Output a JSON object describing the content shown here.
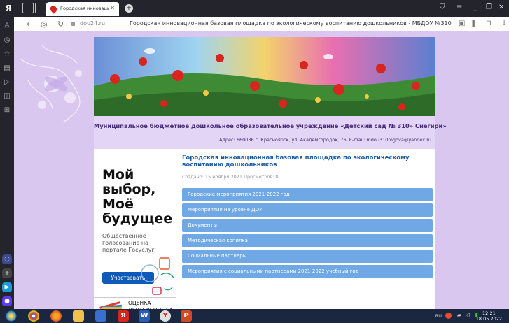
{
  "browser": {
    "tab_title": "Городская инновацио",
    "tab_close": "✕",
    "new_tab": "+",
    "url": "dou24.ru",
    "page_title": "Городская инновационная базовая площадка по экологическому воспитанию дошкольников - МБДОУ №310"
  },
  "site": {
    "org_name": "Муниципальное бюджетное дошкольное образовательное учреждение «Детский сад № 310» Снегири»",
    "address": "Адрес: 660036 г. Красноярск, ул. Академгородок, 76. E-mail: mdou310rogova@yandex.ru"
  },
  "gos_banner": {
    "headline": "Мой выбор, Моё будущее",
    "subtitle": "Общественное голосование на портале Госуслуг",
    "button_label": "Участвовать"
  },
  "rating": {
    "label": "ОЦЕНКА ДЕЯТЕЛЬНОСТИ"
  },
  "article": {
    "title": "Городская инновационная базовая площадка по экологическому воспитанию дошкольников",
    "meta": "Создано: 15 ноября 2021    Просмотров: 0"
  },
  "menu_items": [
    "Городские мероприятия 2021-2022 год",
    "Мероприятия на уровне ДОУ",
    "Документы",
    "Методическая копилка",
    "Социальные партнеры",
    "Мероприятия с социальными партнерами 2021-2022 учебный год"
  ],
  "taskbar": {
    "lang": "RU",
    "time": "12:21",
    "date": "18.05.2022"
  },
  "colors": {
    "page_bg": "#d9c7ef",
    "menu_item": "#6fa8e4",
    "org_text": "#4a2c7a",
    "title_blue": "#1d5ea6",
    "gos_button": "#0d5ab9"
  }
}
